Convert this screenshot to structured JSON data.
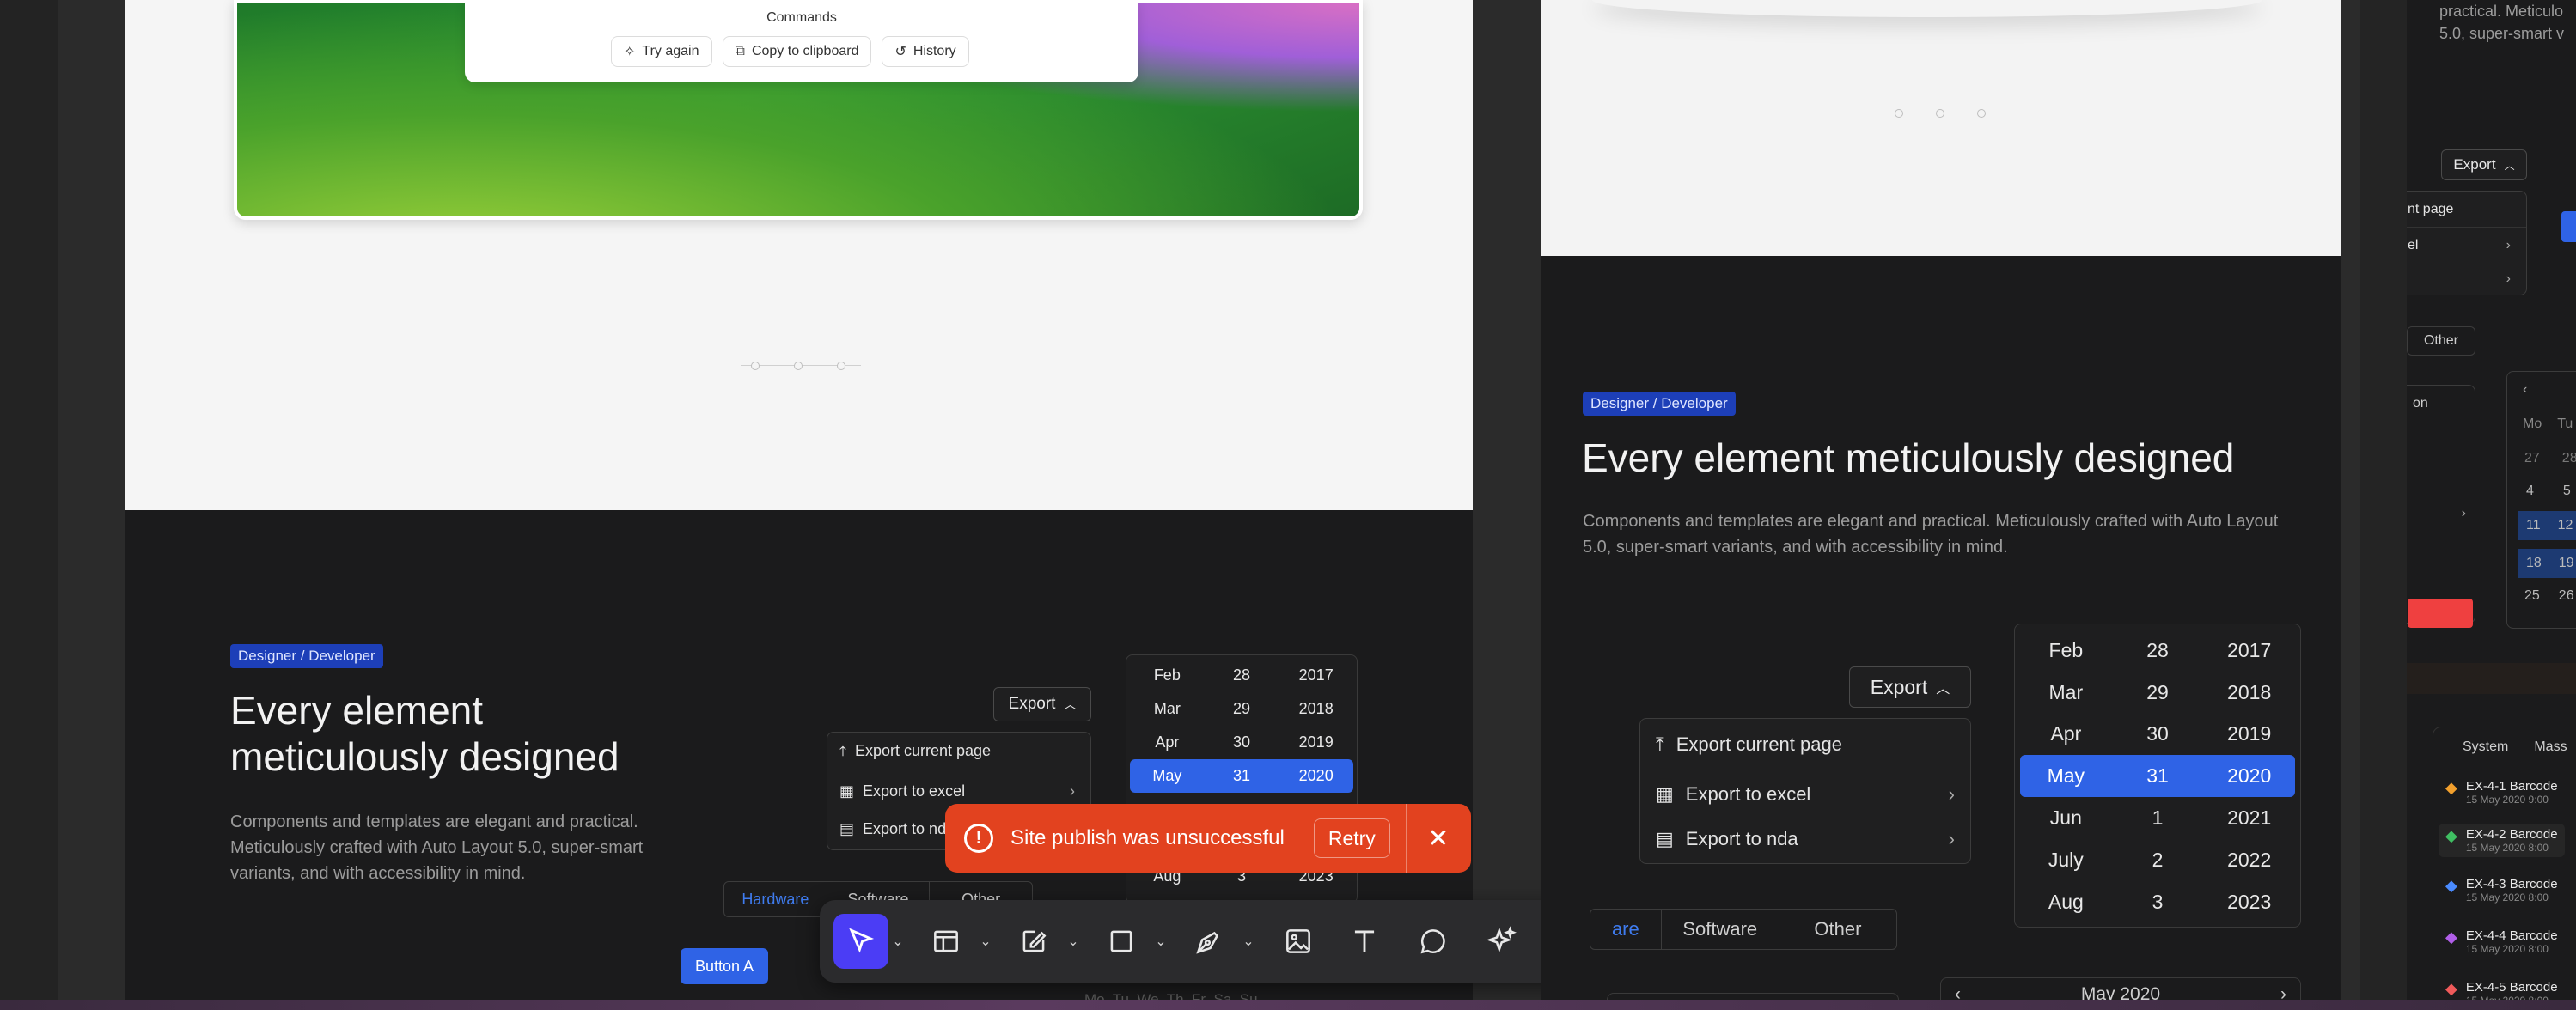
{
  "commands": {
    "title": "Commands",
    "buttons": [
      "Try again",
      "Copy to clipboard",
      "History"
    ]
  },
  "left": {
    "badge": "Designer / Developer",
    "title_line1": "Every element",
    "title_line2": "meticulously designed",
    "desc_line1": "Components and templates are elegant and practical.",
    "desc_line2": "Meticulously crafted with Auto Layout 5.0, super-smart",
    "desc_line3": "variants, and with accessibility in mind.",
    "export_label": "Export",
    "menu": [
      "Export current page",
      "Export to excel",
      "Export to nda"
    ],
    "tabs": [
      "Hardware",
      "Software",
      "Other"
    ],
    "button_a": "Button A",
    "picker": [
      [
        "Feb",
        "28",
        "2017"
      ],
      [
        "Mar",
        "29",
        "2018"
      ],
      [
        "Apr",
        "30",
        "2019"
      ],
      [
        "May",
        "31",
        "2020"
      ],
      [
        "Aug",
        "3",
        "2023"
      ]
    ],
    "weekdays": "Mo  Tu  We  Th  Fr  Sa  Su"
  },
  "toast": {
    "message": "Site publish was unsuccessful",
    "retry": "Retry"
  },
  "right": {
    "badge": "Designer / Developer",
    "title": "Every element meticulously designed",
    "desc_line1": "Components and templates are elegant and practical. Meticulously crafted with Auto Layout",
    "desc_line2": "5.0, super-smart variants, and with accessibility in mind.",
    "export_label": "Export",
    "menu": [
      "Export current page",
      "Export to excel",
      "Export to nda"
    ],
    "tabs": [
      "are",
      "Software",
      "Other"
    ],
    "picker": [
      [
        "Feb",
        "28",
        "2017"
      ],
      [
        "Mar",
        "29",
        "2018"
      ],
      [
        "Apr",
        "30",
        "2019"
      ],
      [
        "May",
        "31",
        "2020"
      ],
      [
        "Jun",
        "1",
        "2021"
      ],
      [
        "July",
        "2",
        "2022"
      ],
      [
        "Aug",
        "3",
        "2023"
      ]
    ],
    "month_label": "May 2020"
  },
  "far_right": {
    "top_text1": "practical. Meticulo",
    "top_text2": "5.0, super-smart v",
    "export_label": "Export",
    "menu": [
      "nt page",
      "el",
      ""
    ],
    "other": "Other",
    "on": "on",
    "cal_head": [
      "Mo",
      "Tu"
    ],
    "cal_rows": [
      [
        "27",
        "28"
      ],
      [
        "4",
        "5"
      ],
      [
        "11",
        "12"
      ],
      [
        "18",
        "19"
      ],
      [
        "25",
        "26"
      ]
    ],
    "tabs": [
      "System",
      "Mass"
    ],
    "list": [
      {
        "title": "EX-4-1 Barcode",
        "date": "15 May 2020 9:00"
      },
      {
        "title": "EX-4-2 Barcode",
        "date": "15 May 2020 8:00"
      },
      {
        "title": "EX-4-3 Barcode",
        "date": "15 May 2020 8:00"
      },
      {
        "title": "EX-4-4 Barcode",
        "date": "15 May 2020 8:00"
      },
      {
        "title": "EX-4-5 Barcode",
        "date": "15 May 2020 8:00"
      }
    ]
  },
  "colors": {
    "accent": "#2f63e6",
    "toast": "#e2421f",
    "badge": "#1d3fb8",
    "toolbar_active": "#4b3df5"
  },
  "toolbar_icons": [
    "cursor-icon",
    "frame-icon",
    "edit-shape-icon",
    "rectangle-icon",
    "pen-icon",
    "image-icon",
    "text-icon",
    "comment-icon",
    "ai-sparkle-icon"
  ]
}
